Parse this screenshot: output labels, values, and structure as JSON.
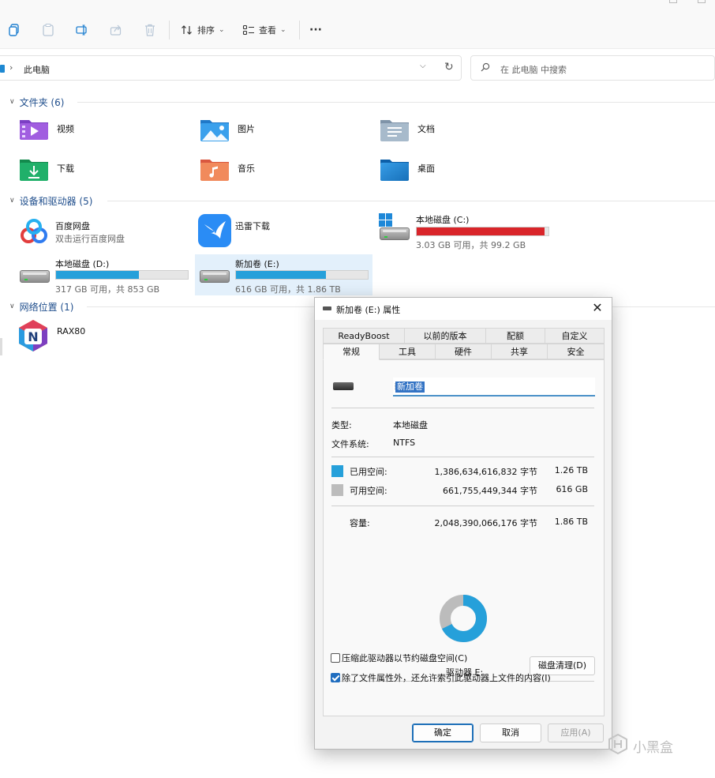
{
  "toolbar": {
    "sort_label": "排序",
    "view_label": "查看",
    "more": "···"
  },
  "address": {
    "path_label": "此电脑",
    "search_placeholder": "在 此电脑 中搜索"
  },
  "sections": {
    "folders": {
      "title": "文件夹 (6)",
      "items": [
        "视频",
        "图片",
        "文档",
        "下载",
        "音乐",
        "桌面"
      ]
    },
    "devices": {
      "title": "设备和驱动器 (5)"
    },
    "network": {
      "title": "网络位置 (1)"
    }
  },
  "devices": {
    "baidu": {
      "name": "百度网盘",
      "sub": "双击运行百度网盘"
    },
    "xunlei": {
      "name": "迅雷下载"
    },
    "c": {
      "name": "本地磁盘 (C:)",
      "sub": "3.03 GB 可用，共 99.2 GB",
      "used_fraction": 0.97
    },
    "d": {
      "name": "本地磁盘 (D:)",
      "sub": "317 GB 可用，共 853 GB",
      "used_fraction": 0.63
    },
    "e": {
      "name": "新加卷 (E:)",
      "sub": "616 GB 可用，共 1.86 TB",
      "used_fraction": 0.68
    }
  },
  "network_items": [
    {
      "name": "RAX80"
    }
  ],
  "dialog": {
    "title": "新加卷 (E:) 属性",
    "tabs_row1": [
      "ReadyBoost",
      "以前的版本",
      "配额",
      "自定义"
    ],
    "tabs_row2": [
      "常规",
      "工具",
      "硬件",
      "共享",
      "安全"
    ],
    "volume_name": "新加卷",
    "type_label": "类型:",
    "type_value": "本地磁盘",
    "fs_label": "文件系统:",
    "fs_value": "NTFS",
    "used": {
      "label": "已用空间:",
      "bytes": "1,386,634,616,832 字节",
      "size": "1.26 TB"
    },
    "free": {
      "label": "可用空间:",
      "bytes": "661,755,449,344 字节",
      "size": "616 GB"
    },
    "capacity": {
      "label": "容量:",
      "bytes": "2,048,390,066,176 字节",
      "size": "1.86 TB"
    },
    "used_fraction": 0.677,
    "drive_label": "驱动器 E:",
    "cleanup_button": "磁盘清理(D)",
    "compress_label": "压缩此驱动器以节约磁盘空间(C)",
    "compress_checked": false,
    "index_label": "除了文件属性外，还允许索引此驱动器上文件的内容(I)",
    "index_checked": true,
    "ok": "确定",
    "cancel": "取消",
    "apply": "应用(A)"
  },
  "watermark": "小黑盒",
  "colors": {
    "used_blue": "#26a0da",
    "free_gray": "#bcbcbc",
    "c_red": "#d9252a",
    "accent": "#1f6dbf"
  }
}
